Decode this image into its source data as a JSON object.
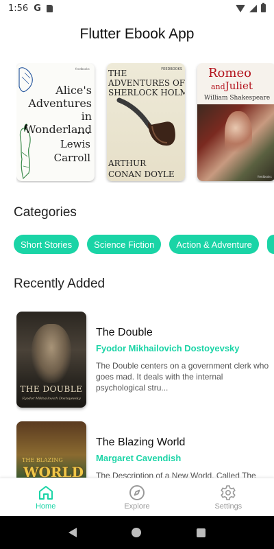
{
  "status_bar": {
    "time": "1:56",
    "notification_icons": [
      "google-icon",
      "sd-card-icon"
    ],
    "system_icons": [
      "wifi-icon",
      "signal-icon",
      "battery-icon"
    ]
  },
  "app": {
    "title": "Flutter Ebook App"
  },
  "featured": [
    {
      "cover": "alice",
      "title": "Alice's Adventures in Wonderland",
      "title_lines": [
        "Alice's",
        "Adventures in",
        "Wonderland"
      ],
      "author_lines": [
        "Lewis",
        "Carroll"
      ],
      "publisher": "feedbooks"
    },
    {
      "cover": "sherlock",
      "title_lines": [
        "THE",
        "ADVENTURES OF",
        "SHERLOCK HOLMES"
      ],
      "author_lines": [
        "ARTHUR",
        "CONAN DOYLE"
      ],
      "publisher": "FEEDBOOKS"
    },
    {
      "cover": "romeo",
      "title_line1": "Romeo",
      "title_and": "and",
      "title_line2": "Juliet",
      "author": "William Shakespeare",
      "publisher": "feedbooks"
    }
  ],
  "categories": {
    "heading": "Categories",
    "items": [
      "Short Stories",
      "Science Fiction",
      "Action & Adventure",
      ""
    ]
  },
  "recent": {
    "heading": "Recently Added",
    "books": [
      {
        "title": "The Double",
        "author": "Fyodor Mikhailovich Dostoyevsky",
        "description": "The Double centers on a government clerk who goes mad. It deals with the internal psychological stru...",
        "cover_title": "THE DOUBLE",
        "cover_author": "Fyodor Mikhailovich Dostoyevsky"
      },
      {
        "title": "The Blazing World",
        "author": "Margaret Cavendish",
        "description": "The Description of a New World, Called The",
        "cover_title_small": "THE BLAZING",
        "cover_title_big": "WORLD"
      }
    ]
  },
  "bottom_nav": {
    "items": [
      {
        "label": "Home",
        "icon": "home-icon",
        "active": true
      },
      {
        "label": "Explore",
        "icon": "compass-icon",
        "active": false
      },
      {
        "label": "Settings",
        "icon": "gear-icon",
        "active": false
      }
    ],
    "active_color": "#1ad4a6",
    "inactive_color": "#999999"
  },
  "theme": {
    "accent": "#1ad4a6"
  }
}
